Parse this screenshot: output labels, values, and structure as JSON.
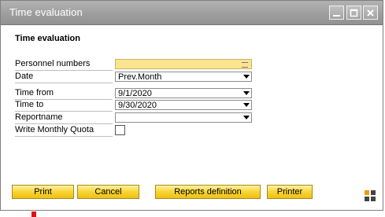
{
  "window": {
    "title": "Time evaluation"
  },
  "form": {
    "heading": "Time evaluation",
    "fields": {
      "personnel_numbers": {
        "label": "Personnel numbers",
        "value": ""
      },
      "date": {
        "label": "Date",
        "value": "Prev.Month"
      },
      "time_from": {
        "label": "Time from",
        "value": "9/1/2020"
      },
      "time_to": {
        "label": "Time to",
        "value": "9/30/2020"
      },
      "reportname": {
        "label": "Reportname",
        "value": ""
      },
      "write_monthly_quota": {
        "label": "Write Monthly Quota",
        "checked": false
      }
    }
  },
  "buttons": {
    "print": {
      "label": "Print"
    },
    "cancel": {
      "label": "Cancel"
    },
    "reports_definition": {
      "label": "Reports definition"
    },
    "printer": {
      "label": "Printer"
    }
  },
  "colors": {
    "titlebar": "#9e9e9e",
    "field_highlight": "#fbe48f",
    "button": "#f9d430"
  }
}
